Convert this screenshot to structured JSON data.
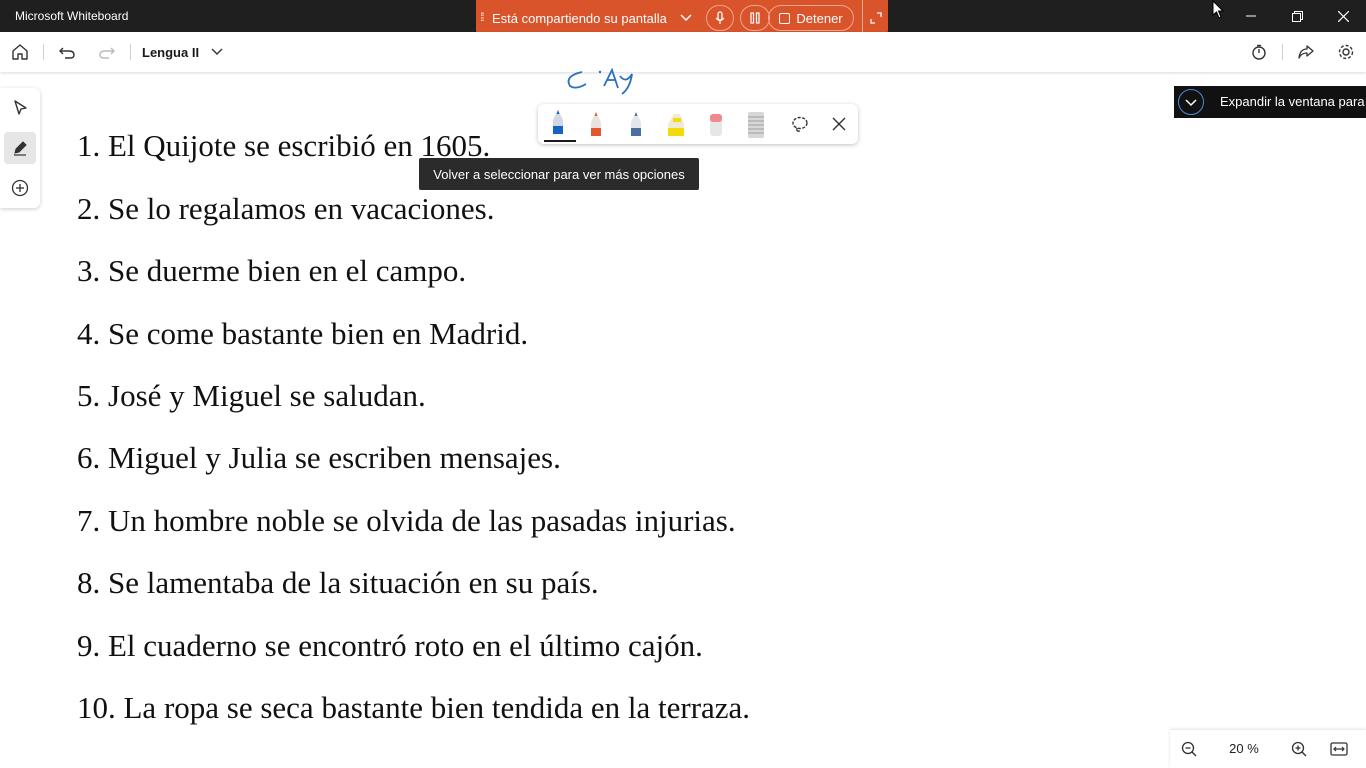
{
  "titlebar": {
    "app_title": "Microsoft Whiteboard",
    "minimize_icon": "minimize-icon",
    "restore_icon": "restore-icon",
    "close_icon": "close-icon"
  },
  "share_bar": {
    "text": "Está compartiendo su pantalla",
    "stop_label": "Detener",
    "color": "#d9532b"
  },
  "toolbar": {
    "board_name": "Lengua II",
    "icons": [
      "home-icon",
      "undo-icon",
      "redo-icon",
      "chevron-down-icon",
      "timer-icon",
      "share-icon",
      "settings-icon"
    ]
  },
  "left_rail": {
    "tools": [
      "select-icon",
      "pen-icon",
      "add-icon"
    ],
    "active": "pen-icon"
  },
  "pen_tray": {
    "tools": [
      {
        "name": "pen-blue",
        "color": "#1565c0"
      },
      {
        "name": "pen-red",
        "color": "#e2582c"
      },
      {
        "name": "pen-gray",
        "color": "#4a6e9e"
      },
      {
        "name": "highlighter-yellow",
        "color": "#f5d90a"
      },
      {
        "name": "eraser",
        "color": "#f08a8a"
      },
      {
        "name": "ruler",
        "color": "#bdbdbd"
      }
    ],
    "lasso_icon": "lasso-icon",
    "close_icon": "close-icon"
  },
  "tooltip": {
    "text": "Volver a seleccionar para ver más opciones"
  },
  "expand_banner": {
    "text": "Expandir la ventana para"
  },
  "sentences": [
    "1. El Quijote se escribió en 1605.",
    "2. Se lo regalamos en vacaciones.",
    "3. Se duerme bien en el campo.",
    "4. Se come bastante bien en Madrid.",
    "5. José y Miguel se saludan.",
    "6. Miguel y Julia se escriben mensajes.",
    "7. Un hombre noble se olvida de las pasadas injurias.",
    "8. Se lamentaba de la situación en su país.",
    "9. El cuaderno se encontró roto en el último cajón.",
    "10. La ropa se seca bastante bien tendida en la terraza."
  ],
  "zoom": {
    "level": "20 %"
  }
}
